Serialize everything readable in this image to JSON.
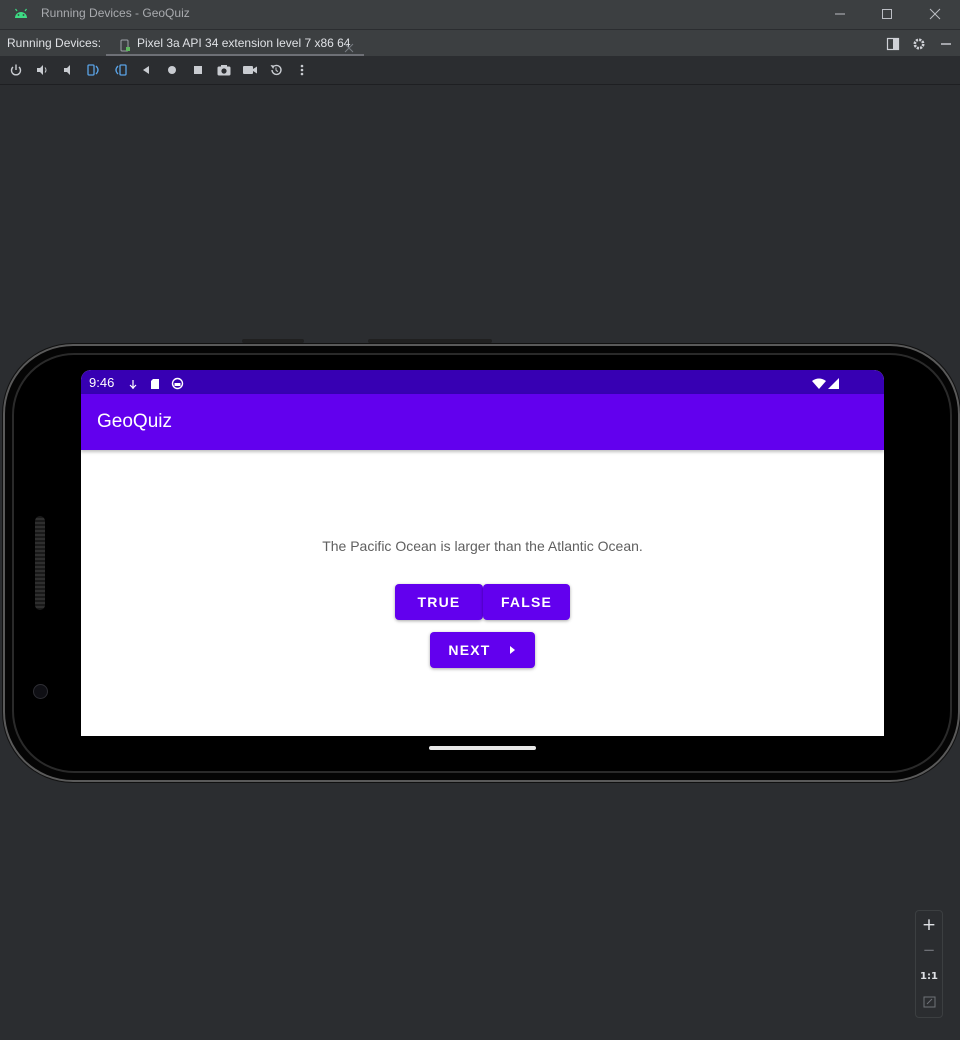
{
  "window": {
    "title": "Running Devices - GeoQuiz",
    "icon": "android-icon",
    "controls": [
      "minimize-icon",
      "maximize-icon",
      "close-icon"
    ]
  },
  "tabbar": {
    "label": "Running Devices:",
    "tab": {
      "label": "Pixel 3a API 34 extension level 7 x86 64",
      "icon": "device-icon",
      "close_icon": "close-icon"
    },
    "right_icons": [
      "split-view-icon",
      "gear-icon",
      "hide-icon"
    ]
  },
  "toolbar": {
    "items": [
      {
        "name": "power-icon"
      },
      {
        "name": "volume-up-icon"
      },
      {
        "name": "volume-down-icon"
      },
      {
        "name": "rotate-left-icon"
      },
      {
        "name": "rotate-right-icon"
      },
      {
        "name": "back-icon"
      },
      {
        "name": "home-icon"
      },
      {
        "name": "overview-icon"
      },
      {
        "name": "camera-icon"
      },
      {
        "name": "record-icon"
      },
      {
        "name": "reset-icon"
      },
      {
        "name": "more-icon"
      }
    ]
  },
  "device": {
    "status_time": "9:46",
    "app_title": "GeoQuiz",
    "question": "The Pacific Ocean is larger than the Atlantic Ocean.",
    "true_label": "TRUE",
    "false_label": "FALSE",
    "next_label": "NEXT",
    "colors": {
      "primary": "#6200ee",
      "primary_dark": "#3700b3"
    }
  },
  "zoom": {
    "zoom_in": "+",
    "zoom_out": "−",
    "actual_size": "1:1",
    "fit_icon": "fit-screen-icon"
  },
  "colors": {
    "ide_bg": "#2b2d30",
    "titlebar_bg": "#3c3f41"
  }
}
